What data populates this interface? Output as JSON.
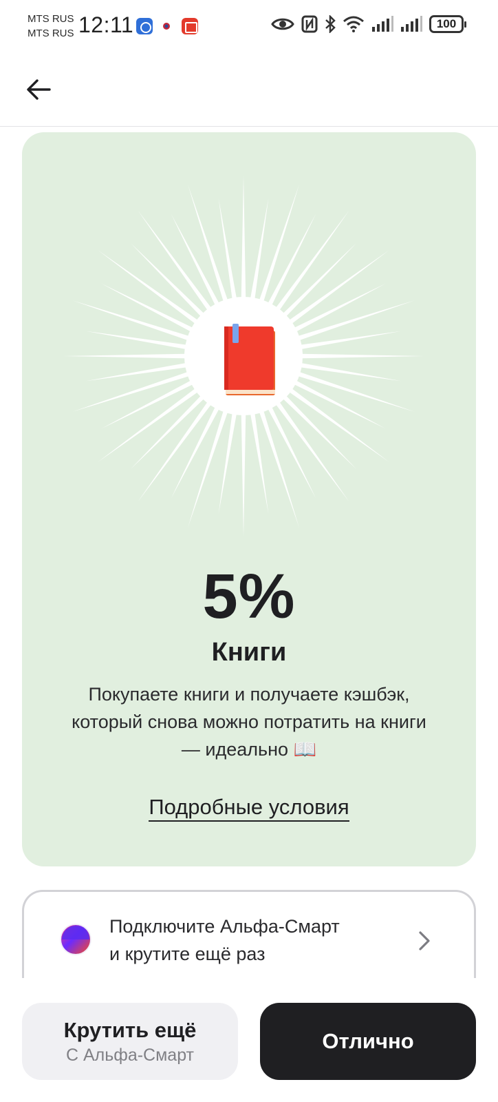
{
  "status_bar": {
    "carrier_1": "MTS RUS",
    "carrier_2": "MTS RUS",
    "time": "12:11",
    "battery": "100"
  },
  "header": {
    "back_icon": "arrow-left-icon"
  },
  "card": {
    "background_color": "#e1efdf",
    "icon": "red-book-icon",
    "percent": "5%",
    "category": "Книги",
    "description": "Покупаете книги и получаете кэшбэк, который снова можно потратить на книги — идеально 📖",
    "terms_link": "Подробные условия"
  },
  "promo": {
    "line_1": "Подключите Альфа-Смарт",
    "line_2": "и крутите ещё раз",
    "icon": "alfa-smart-icon",
    "chevron": "chevron-right-icon"
  },
  "buttons": {
    "spin_title": "Крутить ещё",
    "spin_subtitle": "С Альфа-Смарт",
    "ok_label": "Отлично",
    "ok_color": "#1f1f22"
  }
}
